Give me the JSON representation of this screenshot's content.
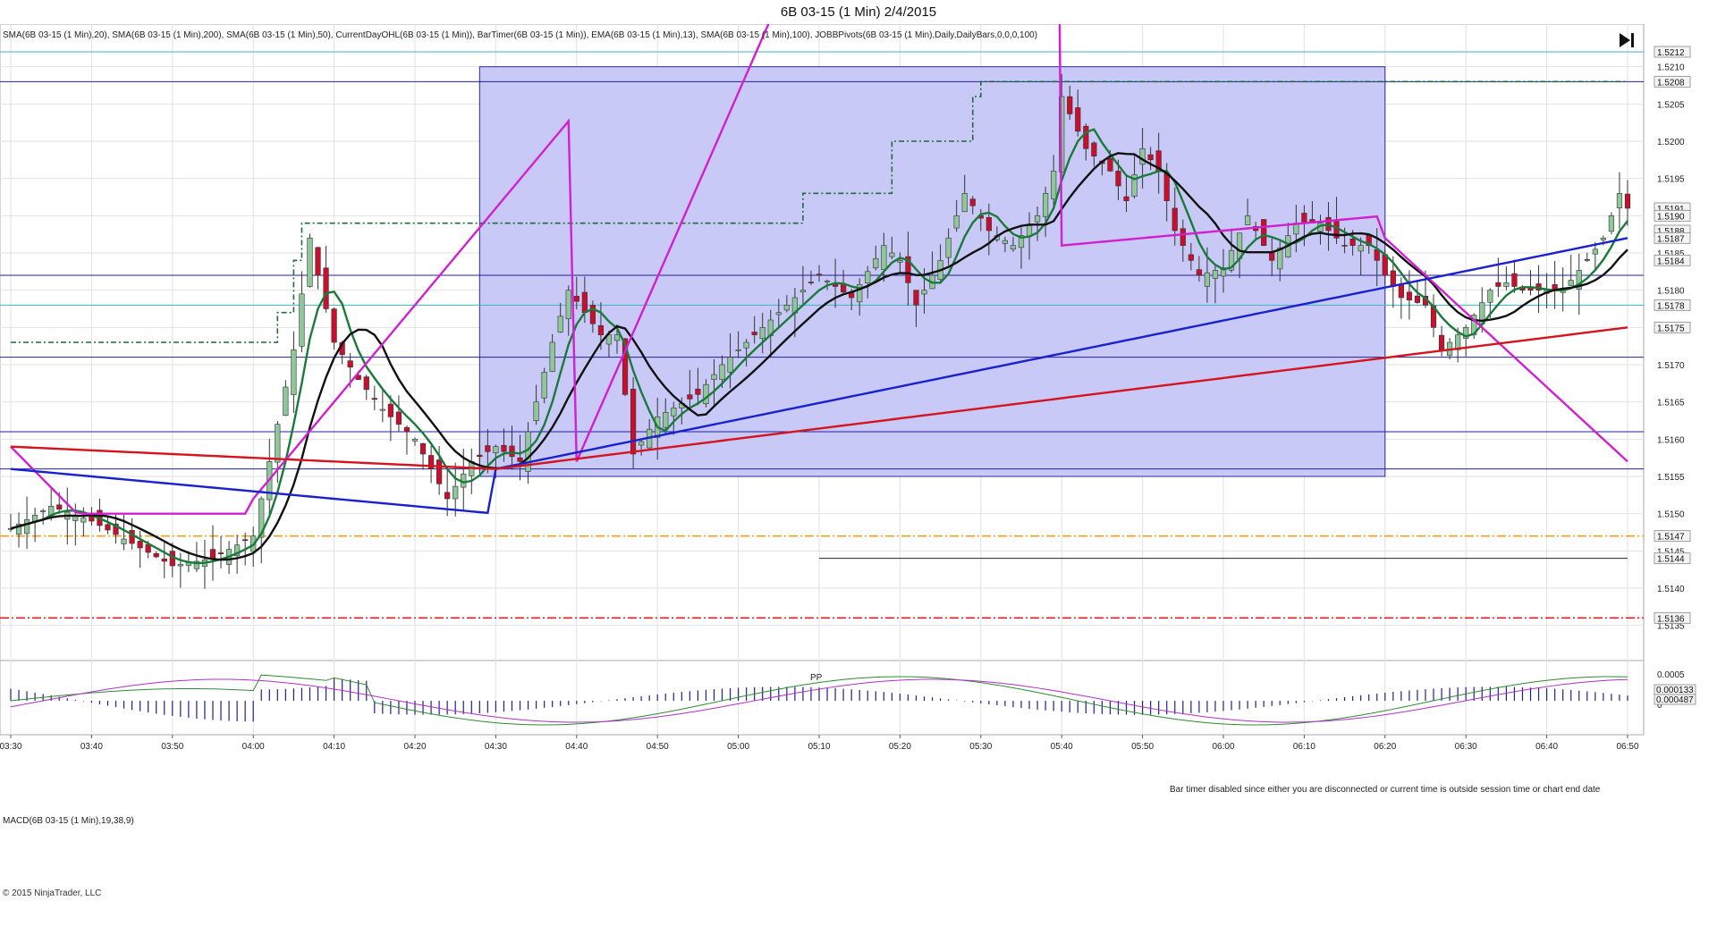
{
  "window": {
    "title": "6B 03-15 (1 Min)  2/4/2015"
  },
  "indicators_label": "SMA(6B 03-15 (1 Min),20), SMA(6B 03-15 (1 Min),200), SMA(6B 03-15 (1 Min),50), CurrentDayOHL(6B 03-15 (1 Min)), BarTimer(6B 03-15 (1 Min)), EMA(6B 03-15 (1 Min),13), SMA(6B 03-15 (1 Min),100), JOBBPivots(6B 03-15 (1 Min),Daily,DailyBars,0,0,0,100)",
  "macd_label": "MACD(6B 03-15 (1 Min),19,38,9)",
  "bar_timer_message": "Bar timer disabled since either you are disconnected or current time is outside session time or chart end date",
  "pivot_label": "PP",
  "copyright": "© 2015 NinjaTrader, LLC",
  "go_to_end_icon": "skip-to-end-icon",
  "colors": {
    "up_candle": "#8fc79b",
    "down_candle": "#c8102e",
    "ema13": "#1a7a3a",
    "sma20": "#111111",
    "sma50": "#d020d0",
    "sma100": "#1a22cc",
    "sma200": "#d4141e",
    "highlight_box": "#c9c9f7",
    "macd_line": "#2e8b2e",
    "macd_signal": "#b030c8",
    "macd_hist": "#20208a"
  },
  "chart_data": {
    "type": "candlestick",
    "title": "6B 03-15 (1 Min)  2/4/2015",
    "x_axis": {
      "labels": [
        "03:30",
        "03:40",
        "03:50",
        "04:00",
        "04:10",
        "04:20",
        "04:30",
        "04:40",
        "04:50",
        "05:00",
        "05:10",
        "05:20",
        "05:30",
        "05:40",
        "05:50",
        "06:00",
        "06:10",
        "06:20",
        "06:30",
        "06:40",
        "06:50"
      ]
    },
    "y_axis": {
      "ticks": [
        1.5135,
        1.514,
        1.5145,
        1.515,
        1.5155,
        1.516,
        1.5165,
        1.517,
        1.5175,
        1.518,
        1.5185,
        1.519,
        1.5195,
        1.52,
        1.5205,
        1.521
      ],
      "range": [
        1.5131,
        1.5215
      ],
      "price_markers": [
        "1.5212",
        "1.5208",
        "1.5191",
        "1.5190",
        "1.5188",
        "1.5187",
        "1.5184",
        "1.5178",
        "1.5175",
        "1.5147",
        "1.5144",
        "1.5136"
      ]
    },
    "horizontal_lines": [
      {
        "price": 1.5208,
        "style": "solid",
        "color": "#2020a0"
      },
      {
        "price": 1.5182,
        "style": "solid",
        "color": "#2020a0"
      },
      {
        "price": 1.5171,
        "style": "solid",
        "color": "#2020a0"
      },
      {
        "price": 1.5161,
        "style": "solid",
        "color": "#2020a0"
      },
      {
        "price": 1.5156,
        "style": "solid",
        "color": "#2020a0"
      },
      {
        "price": 1.5212,
        "style": "solid",
        "color": "#40b0c0"
      },
      {
        "price": 1.5178,
        "style": "solid",
        "color": "#40b0c0"
      },
      {
        "price": 1.5147,
        "style": "dashdot",
        "color": "#f0a020"
      },
      {
        "price": 1.5136,
        "style": "dashdot",
        "color": "#e02020"
      },
      {
        "price": 1.5144,
        "style": "solid",
        "color": "#222222",
        "label": "PP"
      }
    ],
    "highlight_box": {
      "from": "04:28",
      "to": "06:20",
      "price_low": 1.5155,
      "price_high": 1.521
    },
    "session_high_step": [
      {
        "from": "03:30",
        "to": "04:03",
        "price": 1.5173
      },
      {
        "from": "04:03",
        "to": "04:05",
        "price": 1.5177
      },
      {
        "from": "04:05",
        "to": "04:06",
        "price": 1.5184
      },
      {
        "from": "04:06",
        "to": "05:08",
        "price": 1.5189
      },
      {
        "from": "05:08",
        "to": "05:19",
        "price": 1.5193
      },
      {
        "from": "05:19",
        "to": "05:29",
        "price": 1.52
      },
      {
        "from": "05:29",
        "to": "05:30",
        "price": 1.5206
      },
      {
        "from": "05:30",
        "to": "06:50",
        "price": 1.5208
      }
    ],
    "macd": {
      "y_ticks": [
        "0.0005",
        "0"
      ],
      "markers": [
        "0.000133",
        "0.000487"
      ]
    }
  }
}
